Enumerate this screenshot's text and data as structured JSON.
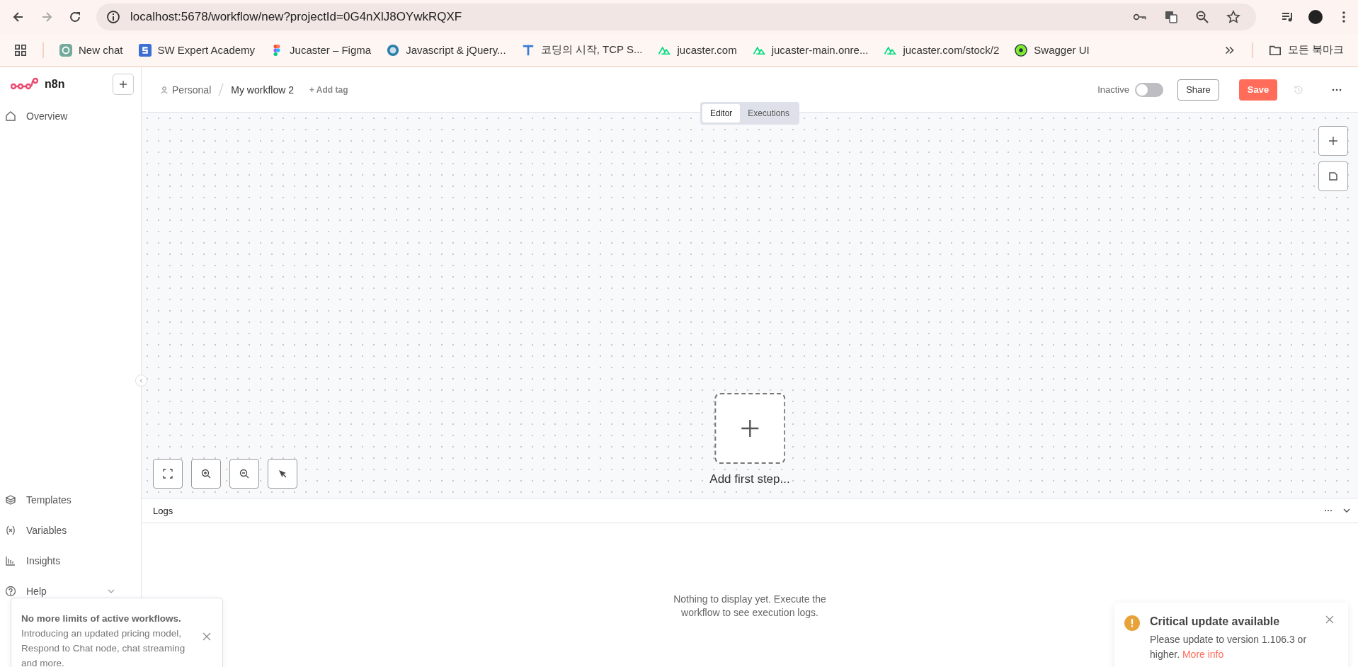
{
  "browser": {
    "address": "localhost:5678/workflow/new?projectId=0G4nXlJ8OYwkRQXF",
    "bookmarks": [
      {
        "label": "New chat",
        "kind": "chat"
      },
      {
        "label": "SW Expert Academy",
        "kind": "square"
      },
      {
        "label": "Jucaster – Figma",
        "kind": "figma"
      },
      {
        "label": "Javascript & jQuery...",
        "kind": "globe"
      },
      {
        "label": "코딩의 시작, TCP S...",
        "kind": "tee"
      },
      {
        "label": "jucaster.com",
        "kind": "peaks"
      },
      {
        "label": "jucaster-main.onre...",
        "kind": "peaks"
      },
      {
        "label": "jucaster.com/stock/2",
        "kind": "peaks"
      },
      {
        "label": "Swagger UI",
        "kind": "swagger"
      }
    ],
    "all_bookmarks": "모든 북마크"
  },
  "sidebar": {
    "logo": "n8n",
    "top_items": [
      {
        "label": "Overview",
        "kind": "home"
      }
    ],
    "bottom_items": [
      {
        "label": "Templates",
        "kind": "box"
      },
      {
        "label": "Variables",
        "kind": "vars"
      },
      {
        "label": "Insights",
        "kind": "chart"
      },
      {
        "label": "Help",
        "kind": "help"
      }
    ]
  },
  "header": {
    "project": "Personal",
    "workflow_name": "My workflow 2",
    "add_tag": "+ Add tag",
    "status": "Inactive",
    "active": false,
    "share": "Share",
    "save": "Save"
  },
  "view_tabs": [
    {
      "label": "Editor",
      "selected": true
    },
    {
      "label": "Executions",
      "selected": false
    }
  ],
  "canvas": {
    "add_first_step": "Add first step..."
  },
  "logs": {
    "title": "Logs",
    "empty_message": "Nothing to display yet. Execute the workflow to see execution logs."
  },
  "notice": {
    "title": "No more limits of active workflows.",
    "body": "Introducing an updated pricing model, Respond to Chat node, chat streaming and more."
  },
  "update_toast": {
    "title": "Critical update available",
    "body": "Please update to version 1.106.3 or higher.",
    "link": "More info"
  }
}
